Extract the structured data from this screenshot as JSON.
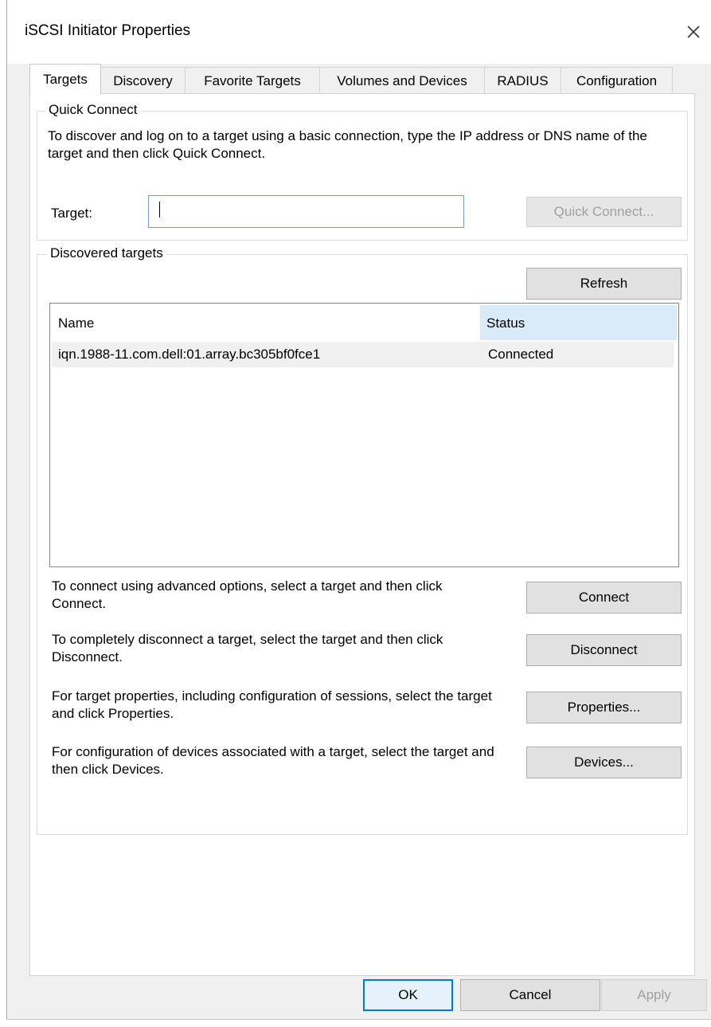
{
  "window": {
    "title": "iSCSI Initiator Properties"
  },
  "tabs": [
    {
      "label": "Targets",
      "active": true
    },
    {
      "label": "Discovery"
    },
    {
      "label": "Favorite Targets"
    },
    {
      "label": "Volumes and Devices"
    },
    {
      "label": "RADIUS"
    },
    {
      "label": "Configuration"
    }
  ],
  "quick_connect": {
    "group_label": "Quick Connect",
    "instructions": "To discover and log on to a target using a basic connection, type the IP address or DNS name of the target and then click Quick Connect.",
    "target_label": "Target:",
    "target_value": "",
    "button_label": "Quick Connect..."
  },
  "discovered": {
    "group_label": "Discovered targets",
    "refresh_label": "Refresh",
    "columns": {
      "name": "Name",
      "status": "Status"
    },
    "rows": [
      {
        "name": "iqn.1988-11.com.dell:01.array.bc305bf0fce1",
        "status": "Connected"
      }
    ],
    "actions": [
      {
        "text": "To connect using advanced options, select a target and then click Connect.",
        "button": "Connect"
      },
      {
        "text": "To completely disconnect a target, select the target and then click Disconnect.",
        "button": "Disconnect"
      },
      {
        "text": "For target properties, including configuration of sessions, select the target and click Properties.",
        "button": "Properties..."
      },
      {
        "text": "For configuration of devices associated with a target, select the target and then click Devices.",
        "button": "Devices..."
      }
    ]
  },
  "footer": {
    "ok": "OK",
    "cancel": "Cancel",
    "apply": "Apply"
  },
  "colors": {
    "accent": "#0078d7",
    "header_highlight": "#d9ebf9",
    "row_highlight": "#f0f0f0"
  }
}
